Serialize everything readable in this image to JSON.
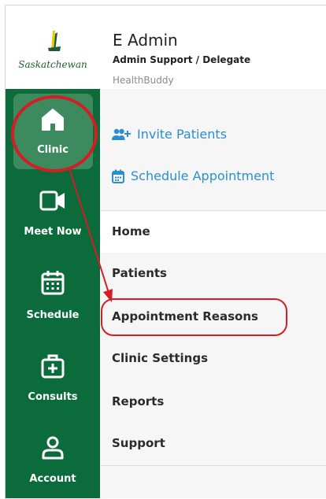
{
  "logo": {
    "text": "Saskatchewan",
    "icon": "wheat-sheaf-icon"
  },
  "header": {
    "name": "E Admin",
    "role": "Admin Support / Delegate",
    "app": "HealthBuddy"
  },
  "sidebar": {
    "items": [
      {
        "label": "Clinic",
        "icon": "home-icon",
        "active": true
      },
      {
        "label": "Meet Now",
        "icon": "video-camera-icon"
      },
      {
        "label": "Schedule",
        "icon": "calendar-icon"
      },
      {
        "label": "Consults",
        "icon": "medical-kit-icon"
      },
      {
        "label": "Account",
        "icon": "person-icon"
      }
    ]
  },
  "actions": {
    "invite": {
      "label": "Invite Patients",
      "icon": "add-users-icon"
    },
    "schedule": {
      "label": "Schedule Appointment",
      "icon": "calendar-icon"
    }
  },
  "menu": {
    "items": [
      {
        "label": "Home",
        "selected": true
      },
      {
        "label": "Patients"
      },
      {
        "label": "Appointment Reasons",
        "annotated": true
      },
      {
        "label": "Clinic Settings"
      },
      {
        "label": "Reports"
      },
      {
        "label": "Support"
      }
    ]
  },
  "colors": {
    "sidebar": "#0b6b3a",
    "sidebar_active": "#3c8a5e",
    "link": "#2a8fd0",
    "annotation": "#d31e25"
  }
}
